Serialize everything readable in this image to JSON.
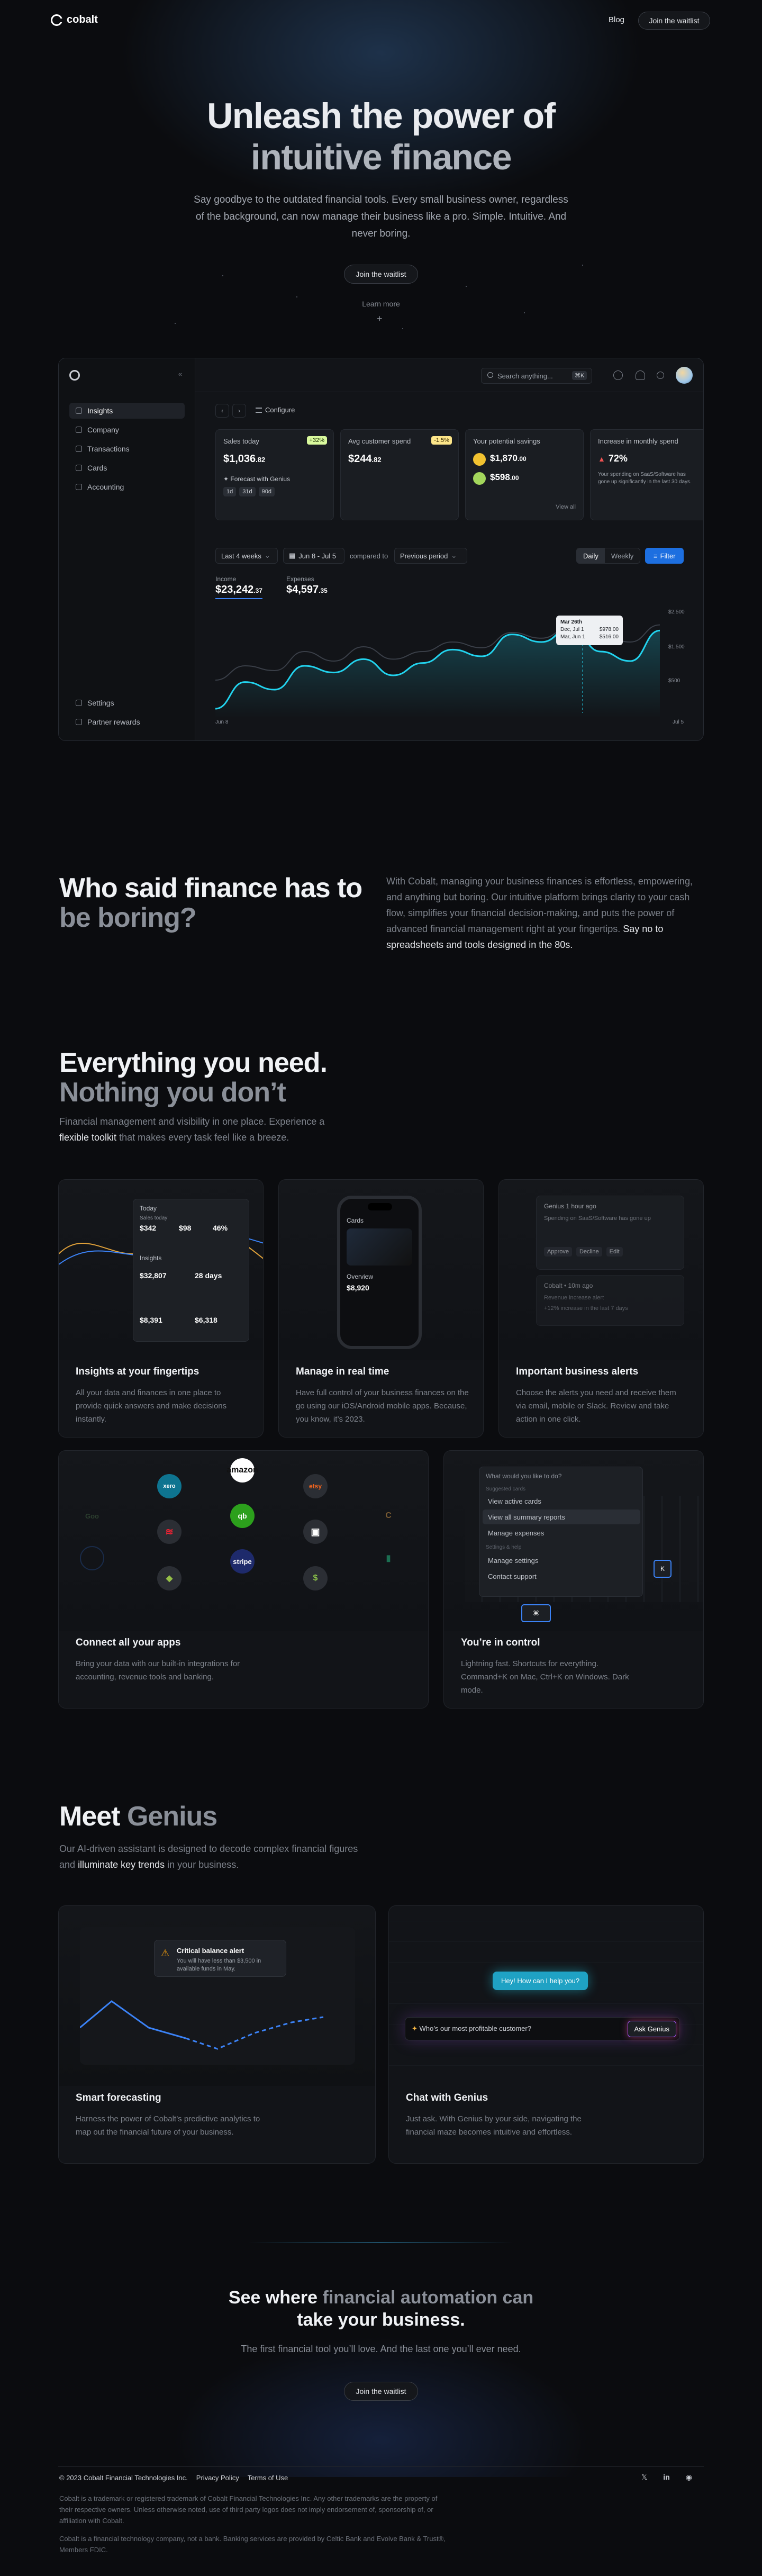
{
  "nav": {
    "brand": "cobalt",
    "blog": "Blog",
    "waitlist": "Join the waitlist"
  },
  "hero": {
    "title_line1": "Unleash the power of",
    "title_line2": "intuitive finance",
    "subtitle": "Say goodbye to the outdated financial tools. Every small business owner, regardless of the background, can now manage their business like a pro. Simple. Intuitive. And never boring.",
    "cta": "Join the waitlist",
    "learn_more": "Learn more",
    "learn_plus": "+"
  },
  "dashboard": {
    "sidebar": {
      "items": [
        "Insights",
        "Company",
        "Transactions",
        "Cards",
        "Accounting"
      ],
      "bottom": [
        "Settings",
        "Partner rewards"
      ],
      "collapse": "«"
    },
    "search": {
      "placeholder": "Search anything...",
      "shortcut": "⌘K"
    },
    "configure": "Configure",
    "cards": [
      {
        "label": "Sales today",
        "badge": "+32%",
        "value": "$1,036",
        "cents": ".82",
        "forecast": "Forecast with Genius",
        "chips": [
          "1d",
          "31d",
          "90d"
        ]
      },
      {
        "label": "Avg customer spend",
        "badge": "-1.5%",
        "value": "$244",
        "cents": ".82"
      },
      {
        "label": "Your potential savings",
        "v1": "$1,870",
        "c1": ".00",
        "v2": "$598",
        "c2": ".00",
        "link": "View all"
      },
      {
        "label": "Increase in monthly spend",
        "value": "72%",
        "desc": "Your spending on SaaS/Software has gone up significantly in the last 30 days."
      }
    ],
    "controls": {
      "range": "Last 4 weeks",
      "dates": "Jun 8 - Jul 5",
      "compared": "compared to",
      "period": "Previous period",
      "daily": "Daily",
      "weekly": "Weekly",
      "filter": "Filter"
    },
    "metrics": {
      "income_label": "Income",
      "income": "$23,242",
      "income_c": ".37",
      "expenses_label": "Expenses",
      "expenses": "$4,597",
      "expenses_c": ".35"
    },
    "tooltip": {
      "title": "Mar 26th",
      "r1": "Dec, Jul 1",
      "v1": "$978.00",
      "r2": "Mar, Jun 1",
      "v2": "$516.00"
    },
    "axis": {
      "y": [
        "$2,500",
        "$1,500",
        "$500"
      ],
      "x_start": "Jun 8",
      "x_end": "Jul 5"
    }
  },
  "chart_data": {
    "type": "line",
    "series": [
      {
        "values": [
          10,
          38,
          30,
          55,
          48,
          62,
          45,
          58,
          72,
          65,
          88,
          80,
          95,
          70,
          60,
          92
        ]
      },
      {
        "values": [
          40,
          55,
          50,
          70,
          60,
          75,
          62,
          70,
          80,
          74,
          90,
          84,
          96,
          88,
          80,
          98
        ]
      }
    ]
  },
  "boring": {
    "title_w": "Who said finance has to",
    "title_g": "be boring?",
    "body": "With Cobalt, managing your business finances is effortless, empowering, and anything but boring. Our intuitive platform brings clarity to your cash flow, simplifies your financial decision-making, and puts the power of advanced financial management right at your fingertips.",
    "body_hl": "Say no to spreadsheets and tools designed in the 80s."
  },
  "everything": {
    "title_w": "Everything you need.",
    "title_g": "Nothing you don’t",
    "body": "Financial management and visibility in one place. Experience a",
    "body_hl": "flexible toolkit",
    "body_end": "that makes every task feel like a breeze."
  },
  "features": [
    {
      "title": "Insights at your fingertips",
      "desc": "All your data and finances in one place to provide quick answers and make decisions instantly."
    },
    {
      "title": "Manage in real time",
      "desc": "Have full control of your business finances on the go using our iOS/Android mobile apps. Because, you know, it’s 2023."
    },
    {
      "title": "Important business alerts",
      "desc": "Choose the alerts you need and receive them via email, mobile or Slack. Review and take action in one click."
    },
    {
      "title": "Connect all your apps",
      "desc": "Bring your data with our built-in integrations for accounting, revenue tools and banking."
    },
    {
      "title": "You’re in control",
      "desc": "Lightning fast. Shortcuts for everything. Command+K on Mac, Ctrl+K on Windows. Dark mode."
    }
  ],
  "insights_mock": {
    "today": "Today",
    "sales": "Sales today",
    "sales_v": "$342",
    "revenue": "$98",
    "ratio": "46%",
    "insights": "Insights",
    "cash": "$32,807",
    "days": "28 days",
    "bal": "$8,391",
    "exp": "$6,318"
  },
  "phone_mock": {
    "title": "Cards",
    "overview": "Overview",
    "balance": "$8,920"
  },
  "alerts_mock": {
    "a1": "Genius 1 hour ago",
    "a1b": "Spending on SaaS/Software has gone up",
    "a1c": "Approve",
    "a1d": "Decline",
    "a1e": "Edit",
    "a2": "Cobalt • 10m ago",
    "a2b": "Revenue increase alert",
    "a2c": "+12% increase in the last 7 days"
  },
  "apps": [
    "amazon",
    "etsy",
    "qb",
    "stripe",
    "shop",
    "square"
  ],
  "control_mock": {
    "prompt": "What would you like to do?",
    "r0": "View active cards",
    "r1": "View all summary reports",
    "r2": "Manage expenses",
    "r3": "Manage settings",
    "r4": "Contact support",
    "sec1": "Suggested cards",
    "sec2": "Settings & help",
    "key": "K",
    "key2": "⌘"
  },
  "genius": {
    "title_w": "Meet",
    "title_g": "Genius",
    "body": "Our AI-driven assistant is designed to decode complex financial figures and",
    "body_hl": "illuminate key trends",
    "body_end": "in your business."
  },
  "genius_cards": [
    {
      "title": "Smart forecasting",
      "desc": "Harness the power of Cobalt’s predictive analytics to map out the financial future of your business.",
      "alert": "Critical balance alert",
      "alert_b": "You will have less than $3,500 in available funds in May."
    },
    {
      "title": "Chat with Genius",
      "desc": "Just ask. With Genius by your side, navigating the financial maze becomes intuitive and effortless.",
      "bubble": "Hey! How can I help you?",
      "question": "Who’s our most profitable customer?",
      "ask": "Ask Genius"
    }
  ],
  "cta": {
    "title_w1": "See where",
    "title_g": "financial automation can",
    "title_w2": "take your business.",
    "body": "The first financial tool you’ll love. And the last one you’ll ever need.",
    "button": "Join the waitlist"
  },
  "footer": {
    "copyright": "© 2023 Cobalt Financial Technologies Inc.",
    "privacy": "Privacy Policy",
    "terms": "Terms of Use",
    "legal1": "Cobalt is a trademark or registered trademark of Cobalt Financial Technologies Inc. Any other trademarks are the property of their respective owners. Unless otherwise noted, use of third party logos does not imply endorsement of, sponsorship of, or affiliation with Cobalt.",
    "legal2": "Cobalt is a financial technology company, not a bank. Banking services are provided by Celtic Bank and Evolve Bank & Trust®, Members FDIC."
  }
}
